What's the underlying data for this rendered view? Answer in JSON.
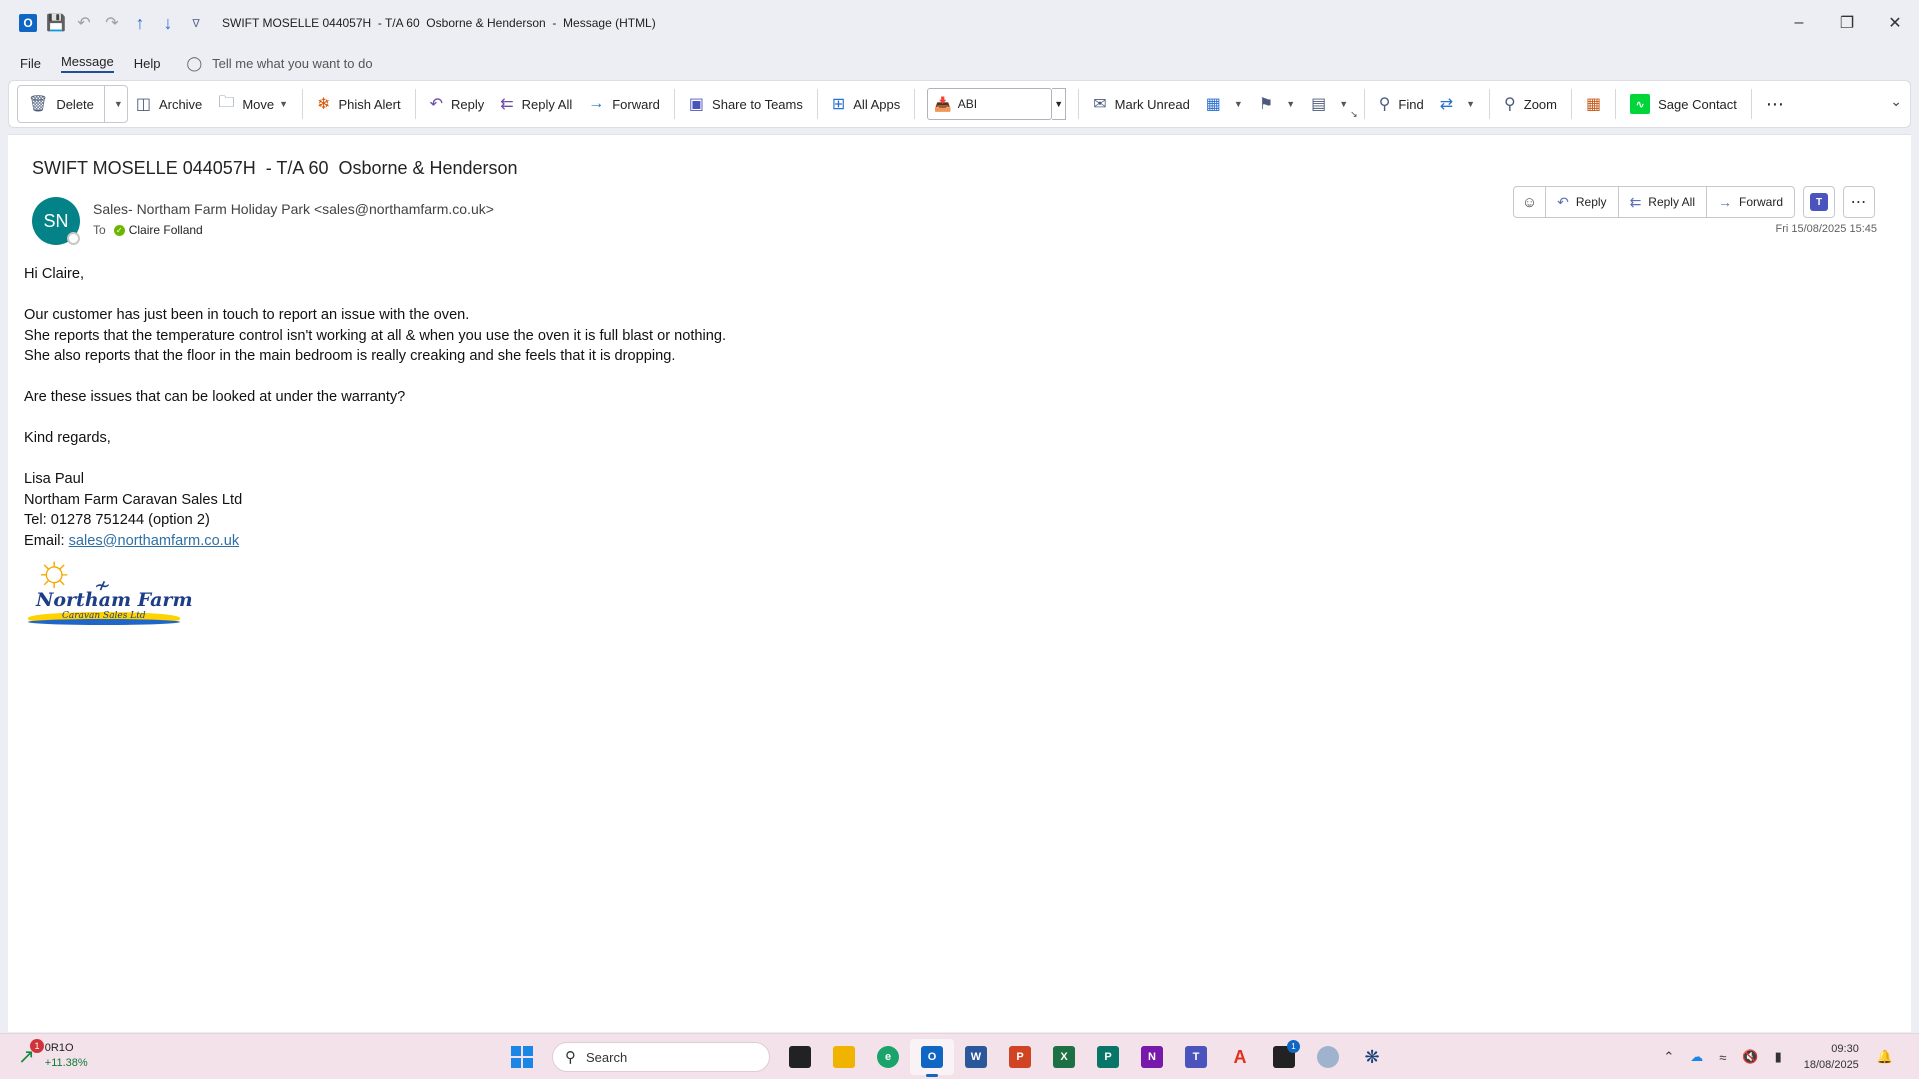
{
  "window": {
    "title": "SWIFT MOSELLE 044057H  - T/A 60  Osborne & Henderson  -  Message (HTML)"
  },
  "menu": {
    "file": "File",
    "message": "Message",
    "help": "Help",
    "tell_me": "Tell me what you want to do"
  },
  "ribbon": {
    "delete": "Delete",
    "archive": "Archive",
    "move": "Move",
    "phish_alert": "Phish Alert",
    "reply": "Reply",
    "reply_all": "Reply All",
    "forward": "Forward",
    "share_to_teams": "Share to Teams",
    "all_apps": "All Apps",
    "abi": "ABI",
    "mark_unread": "Mark Unread",
    "find": "Find",
    "zoom": "Zoom",
    "sage_contact": "Sage Contact"
  },
  "message": {
    "subject": "SWIFT MOSELLE 044057H  - T/A 60  Osborne & Henderson",
    "avatar_initials": "SN",
    "sender": "Sales- Northam Farm Holiday Park <sales@northamfarm.co.uk>",
    "to_label": "To",
    "recipient": "Claire Folland",
    "date": "Fri 15/08/2025 15:45",
    "actions": {
      "reply": "Reply",
      "reply_all": "Reply All",
      "forward": "Forward"
    },
    "body": {
      "greeting": "Hi Claire,",
      "line1": "Our customer has just been in touch to report an issue with the oven.",
      "line2": "She reports that the temperature control isn't working at all & when you use the oven it is full blast or nothing.",
      "line3": "She also reports that the floor in the main bedroom is really creaking and she feels that it is dropping.",
      "question": "Are these issues that can be looked at under the warranty?",
      "signoff": "Kind regards,",
      "sig_name": "Lisa Paul",
      "sig_company": "Northam Farm Caravan Sales Ltd",
      "sig_tel": "Tel: 01278 751244 (option 2)",
      "sig_email_label": "Email: ",
      "sig_email": "sales@northamfarm.co.uk"
    },
    "logo": {
      "name": "Northam Farm",
      "sub": "Caravan Sales Ltd"
    }
  },
  "taskbar": {
    "stock_ticker": "0R1O",
    "stock_change": "+11.38%",
    "stock_badge": "1",
    "search_placeholder": "Search",
    "app_badge": "1",
    "time": "09:30",
    "date": "18/08/2025"
  },
  "colors": {
    "accent": "#1066c3",
    "avatar": "#038387",
    "link": "#2e6fa5",
    "taskbar": "#f3e2e9"
  }
}
